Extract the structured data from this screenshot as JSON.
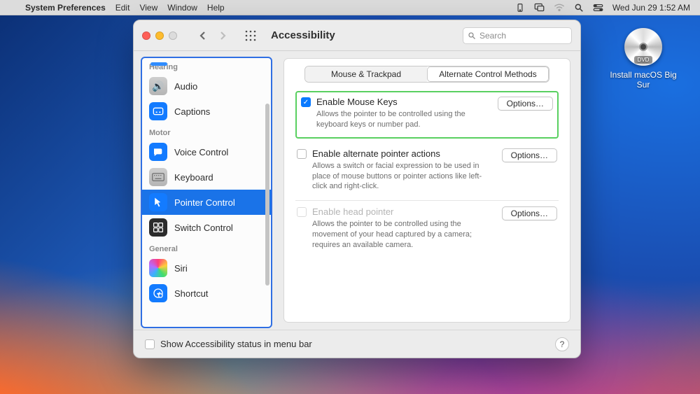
{
  "menubar": {
    "app_name": "System Preferences",
    "items": [
      "Edit",
      "View",
      "Window",
      "Help"
    ],
    "clock": "Wed Jun 29  1:52 AM"
  },
  "desktop": {
    "dvd_label": "Install macOS Big Sur",
    "dvd_tag": "DVD"
  },
  "window": {
    "title": "Accessibility",
    "search_placeholder": "Search"
  },
  "sidebar": {
    "cat_hearing": "Hearing",
    "cat_motor": "Motor",
    "cat_general": "General",
    "items": {
      "audio": "Audio",
      "captions": "Captions",
      "voice_control": "Voice Control",
      "keyboard": "Keyboard",
      "pointer_control": "Pointer Control",
      "switch_control": "Switch Control",
      "siri": "Siri",
      "shortcut": "Shortcut"
    }
  },
  "tabs": {
    "mouse": "Mouse & Trackpad",
    "alt": "Alternate Control Methods"
  },
  "groups": {
    "mousekeys": {
      "label": "Enable Mouse Keys",
      "desc": "Allows the pointer to be controlled using the keyboard keys or number pad.",
      "options": "Options…"
    },
    "altpointer": {
      "label": "Enable alternate pointer actions",
      "desc": "Allows a switch or facial expression to be used in place of mouse buttons or pointer actions like left-click and right-click.",
      "options": "Options…"
    },
    "headpointer": {
      "label": "Enable head pointer",
      "desc": "Allows the pointer to be controlled using the movement of your head captured by a camera; requires an available camera.",
      "options": "Options…"
    }
  },
  "footer": {
    "label": "Show Accessibility status in menu bar",
    "help": "?"
  }
}
